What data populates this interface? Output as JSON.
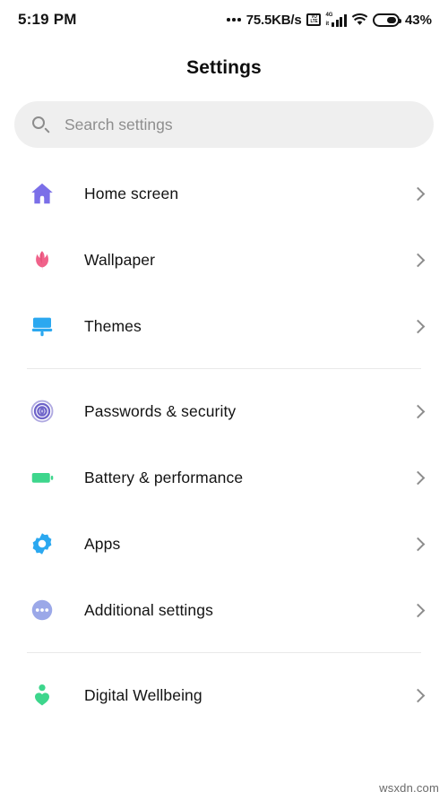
{
  "statusbar": {
    "time": "5:19 PM",
    "network_speed": "75.5KB/s",
    "volte_top": "VO",
    "volte_bottom": "LTE",
    "signal_label": "4G",
    "signal_carrier": "it",
    "battery_percent": "43%",
    "wifi_icon": "wifi-icon",
    "battery_icon": "battery-icon"
  },
  "header": {
    "title": "Settings"
  },
  "search": {
    "placeholder": "Search settings",
    "value": "",
    "icon": "search-icon"
  },
  "groups": [
    {
      "items": [
        {
          "label": "Home screen",
          "icon": "home-icon",
          "color": "#7B6FE8"
        },
        {
          "label": "Wallpaper",
          "icon": "tulip-icon",
          "color": "#F0628A"
        },
        {
          "label": "Themes",
          "icon": "paintbrush-icon",
          "color": "#2BA8F0"
        }
      ]
    },
    {
      "items": [
        {
          "label": "Passwords & security",
          "icon": "fingerprint-icon",
          "color": "#6E63C9"
        },
        {
          "label": "Battery & performance",
          "icon": "battery-icon",
          "color": "#3DD68C"
        },
        {
          "label": "Apps",
          "icon": "gear-icon",
          "color": "#2BA8F0"
        },
        {
          "label": "Additional settings",
          "icon": "more-dots-icon",
          "color": "#9BA8E8"
        }
      ]
    },
    {
      "items": [
        {
          "label": "Digital Wellbeing",
          "icon": "wellbeing-icon",
          "color": "#3DD68C"
        }
      ]
    }
  ],
  "watermark": "wsxdn.com",
  "colors": {
    "background": "#ffffff",
    "search_bg": "#efefef",
    "divider": "#e9e9e9",
    "text": "#131313",
    "chevron": "#8d8d8d"
  }
}
